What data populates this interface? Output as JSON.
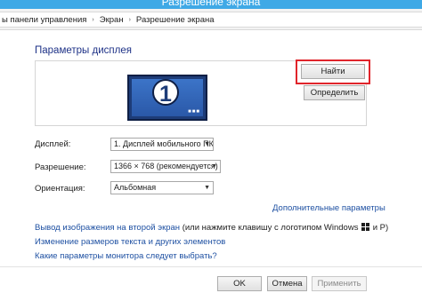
{
  "window": {
    "title": "Разрешение экрана"
  },
  "breadcrumb": {
    "items": [
      "ы панели управления",
      "Экран",
      "Разрешение экрана"
    ],
    "separator": "›"
  },
  "page": {
    "heading": "Параметры дисплея"
  },
  "preview": {
    "monitor_number": "1",
    "find_button": "Найти",
    "identify_button": "Определить"
  },
  "form": {
    "display": {
      "label": "Дисплей:",
      "value": "1. Дисплей мобильного ПК"
    },
    "resolution": {
      "label": "Разрешение:",
      "value": "1366 × 768 (рекомендуется)"
    },
    "orientation": {
      "label": "Ориентация:",
      "value": "Альбомная"
    }
  },
  "links": {
    "advanced": "Дополнительные параметры",
    "second_screen_pre": "Вывод изображения на второй экран",
    "second_screen_post": " (или нажмите клавишу с логотипом Windows ",
    "second_screen_end": " и P)",
    "text_size": "Изменение размеров текста и других элементов",
    "which_params": "Какие параметры монитора следует выбрать?"
  },
  "footer": {
    "ok": "OK",
    "cancel": "Отмена",
    "apply": "Применить"
  },
  "colors": {
    "titlebar": "#3fa9e6",
    "heading": "#1e3287",
    "link": "#1e50a2",
    "highlight": "#e0242b"
  },
  "icons": [
    "windows-logo-icon",
    "chevron-down-icon",
    "breadcrumb-separator-icon"
  ]
}
